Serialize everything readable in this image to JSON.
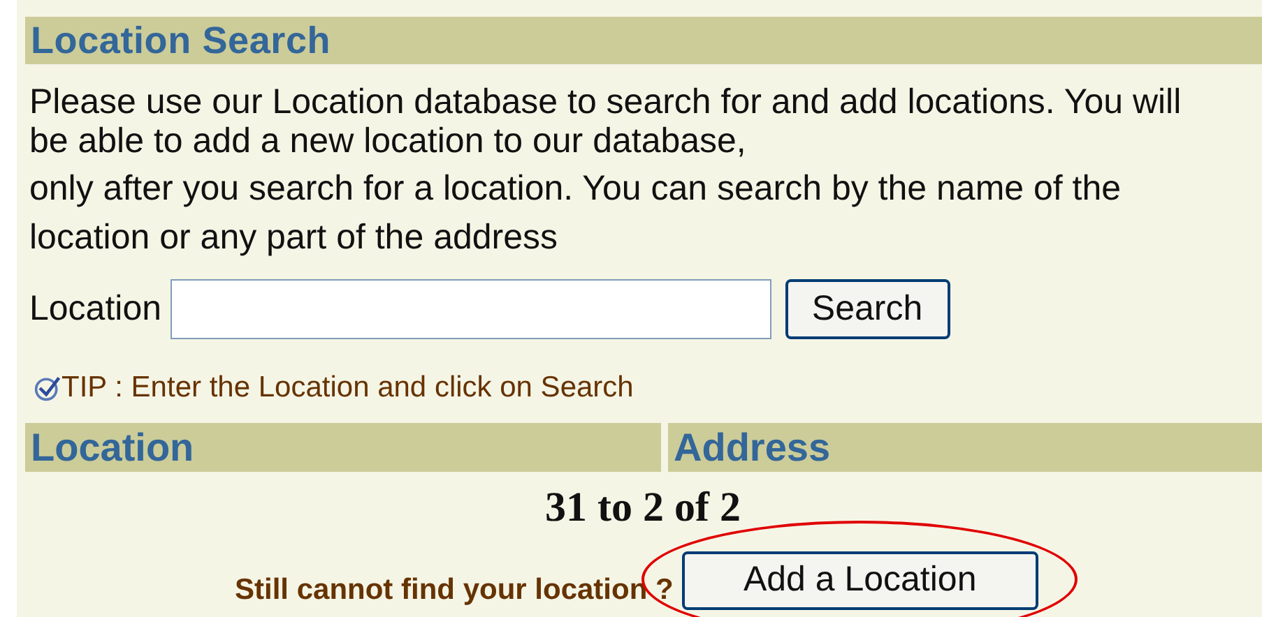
{
  "title": "Location Search",
  "intro_lines": [
    "Please use our Location database to search for and add locations. You will",
    "be able to add a new location to our database,",
    "only after you search for a location. You can search by the name of the",
    "location or any part of the address"
  ],
  "search": {
    "label": "Location",
    "button": "Search"
  },
  "tip": "TIP : Enter the Location and click on Search",
  "table": {
    "columns": [
      "Location",
      "Address"
    ]
  },
  "results_count": "31 to 2 of 2",
  "footer": {
    "prompt": "Still cannot find your location ?",
    "button": "Add a Location",
    "highlighted": true
  }
}
